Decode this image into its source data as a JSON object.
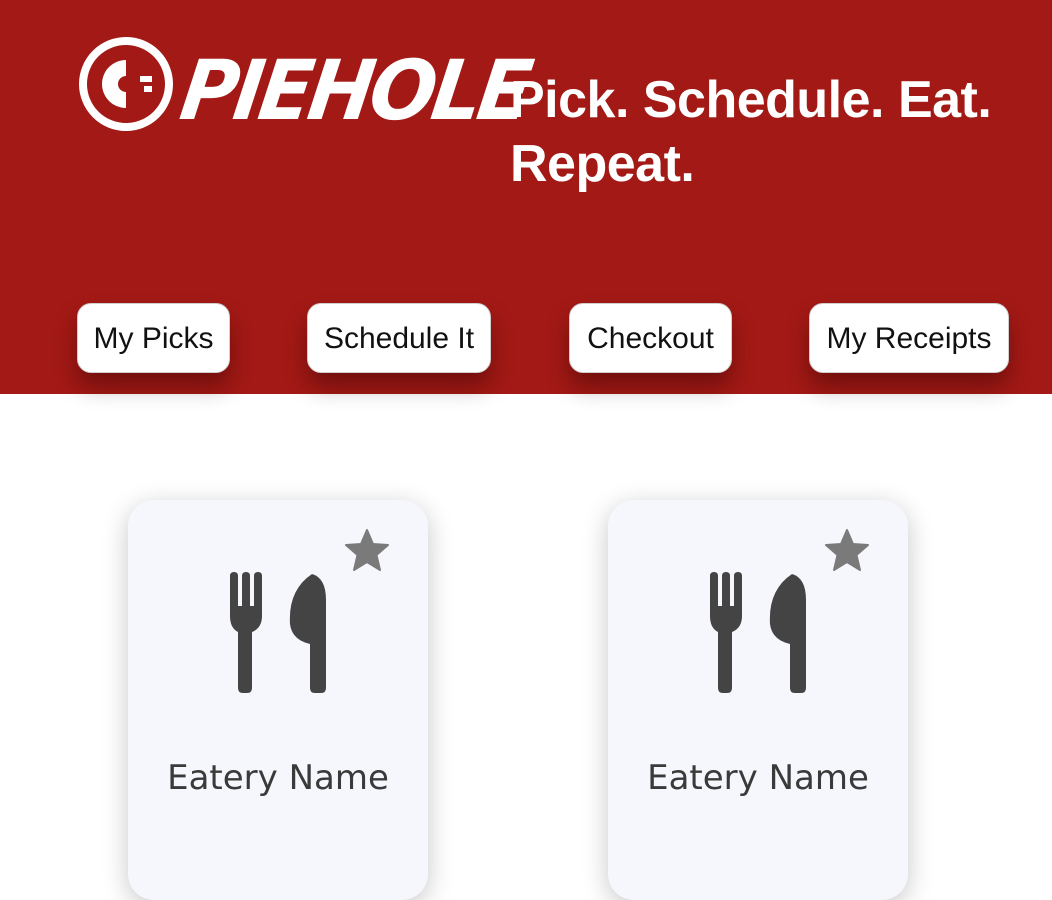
{
  "brand": {
    "name": "PIEHOLE",
    "tagline": "Pick. Schedule. Eat. Repeat.",
    "header_color": "#a31915",
    "logo_icon": "piehole-logo-icon"
  },
  "nav": {
    "my_picks": "My Picks",
    "schedule_it": "Schedule It",
    "checkout": "Checkout",
    "my_receipts": "My Receipts"
  },
  "cards": [
    {
      "name": "Eatery Name",
      "icon": "fork-knife-icon",
      "favorite_icon": "star-icon"
    },
    {
      "name": "Eatery Name",
      "icon": "fork-knife-icon",
      "favorite_icon": "star-icon"
    }
  ]
}
